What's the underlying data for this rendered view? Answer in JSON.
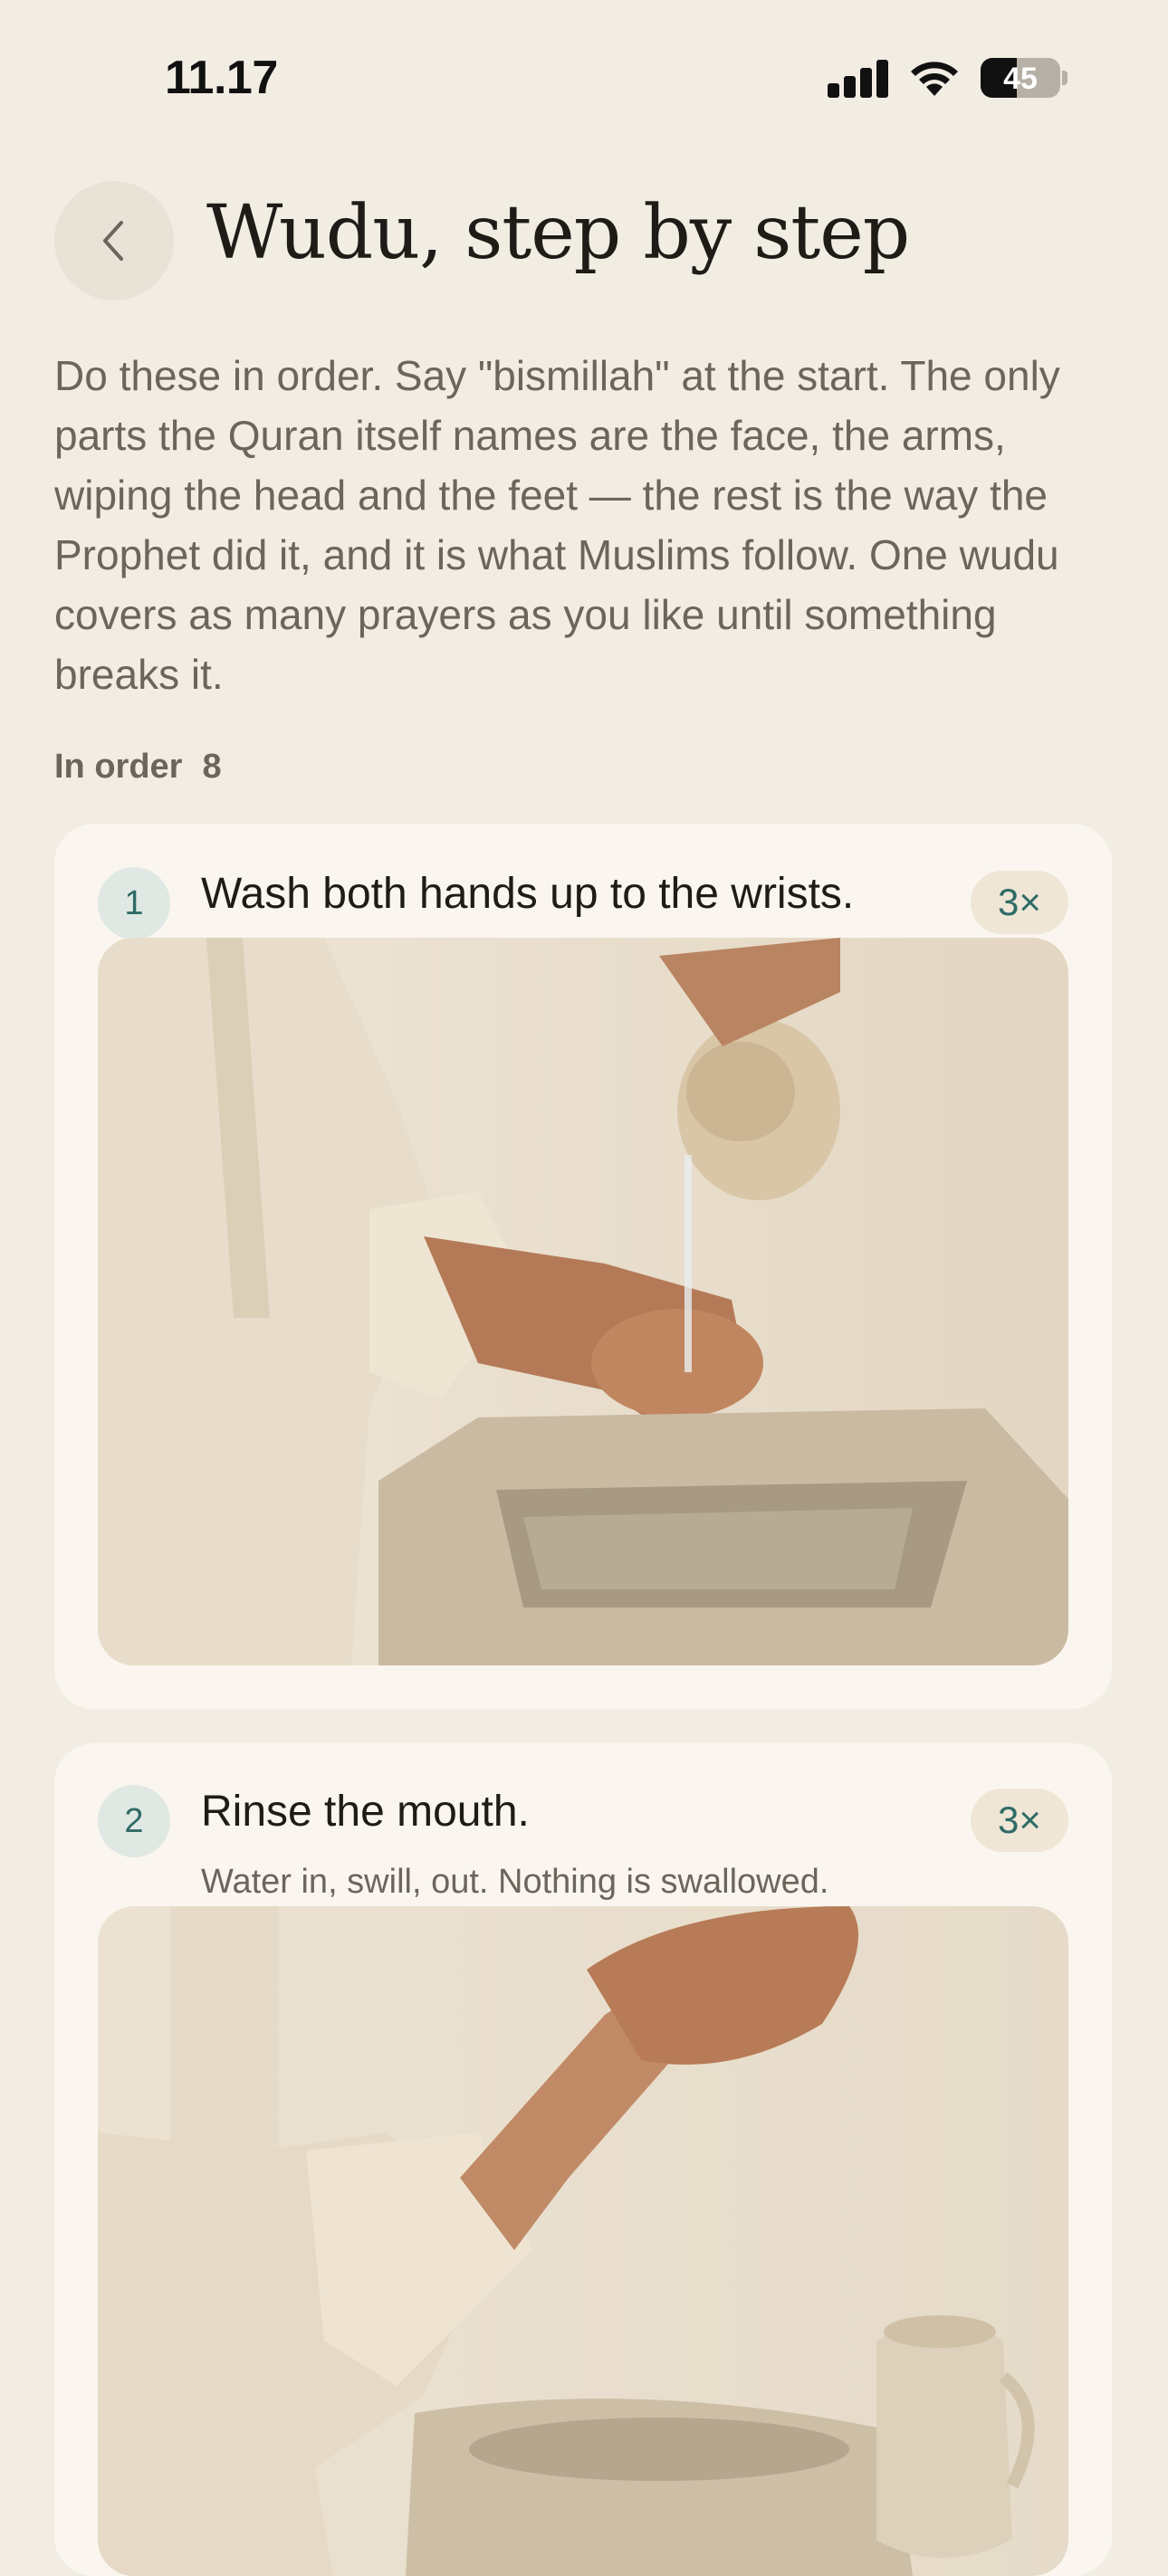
{
  "status": {
    "time": "11.17",
    "battery": "45",
    "icons": [
      "cellular-signal-icon",
      "wifi-icon",
      "battery-icon"
    ]
  },
  "header": {
    "back_icon": "chevron-left-icon",
    "title": "Wudu, step by step"
  },
  "intro": "Do these in order. Say \"bismillah\" at the start. The only parts the Quran itself names are the face, the arms, wiping the head and the feet — the rest is the way the Prophet did it, and it is what Muslims follow. One wudu covers as many prayers as you like until something breaks it.",
  "section": {
    "label": "In order",
    "count": "8"
  },
  "steps": [
    {
      "number": "1",
      "title": "Wash both hands up to the wrists.",
      "subtitle": "",
      "reps": "3×",
      "image": "hands-washing-photo"
    },
    {
      "number": "2",
      "title": "Rinse the mouth.",
      "subtitle": "Water in, swill, out. Nothing is swallowed.",
      "reps": "3×",
      "image": "cupped-hand-water-photo"
    }
  ],
  "colors": {
    "background": "#f2ede3",
    "card": "#faf6ef",
    "accent": "#2f6b66",
    "step_badge": "#dfe8e3",
    "reps_pill": "#efe6d6"
  }
}
